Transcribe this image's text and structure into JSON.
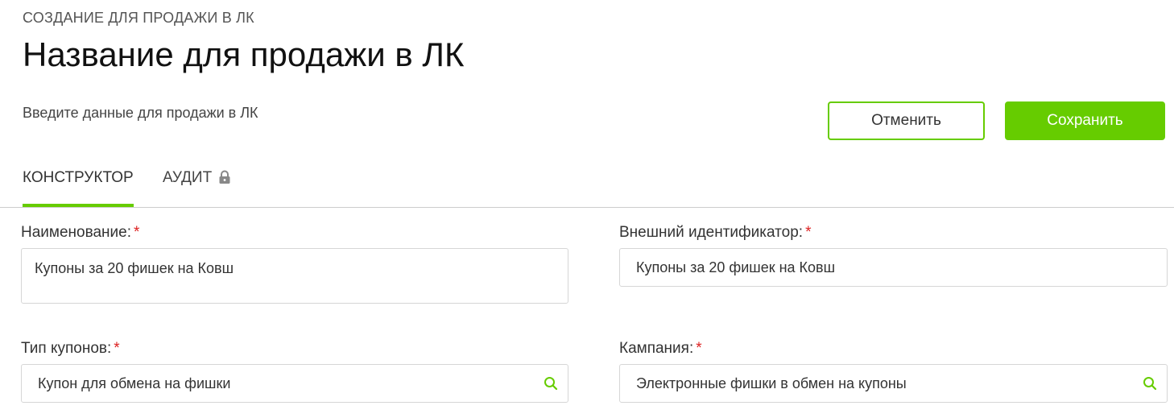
{
  "header": {
    "breadcrumb": "СОЗДАНИЕ ДЛЯ ПРОДАЖИ В ЛК",
    "title": "Название для продажи в ЛК",
    "subtitle": "Введите данные для продажи в ЛК"
  },
  "actions": {
    "cancel_label": "Отменить",
    "save_label": "Сохранить"
  },
  "tabs": [
    {
      "label": "КОНСТРУКТОР",
      "active": true
    },
    {
      "label": "АУДИТ",
      "locked": true,
      "icon": "lock-icon"
    }
  ],
  "form": {
    "name": {
      "label": "Наименование:",
      "required_mark": "*",
      "value": "Купоны за 20 фишек на Ковш"
    },
    "external_id": {
      "label": "Внешний идентификатор:",
      "required_mark": "*",
      "value": "Купоны за 20 фишек на Ковш"
    },
    "coupon_type": {
      "label": "Тип купонов:",
      "required_mark": "*",
      "value": "Купон для обмена на фишки",
      "icon": "search-icon"
    },
    "campaign": {
      "label": "Кампания:",
      "required_mark": "*",
      "value": "Электронные фишки в обмен на купоны",
      "icon": "search-icon"
    }
  },
  "colors": {
    "accent": "#66cc00",
    "required": "#dd2222",
    "border": "#d6d6d6"
  }
}
